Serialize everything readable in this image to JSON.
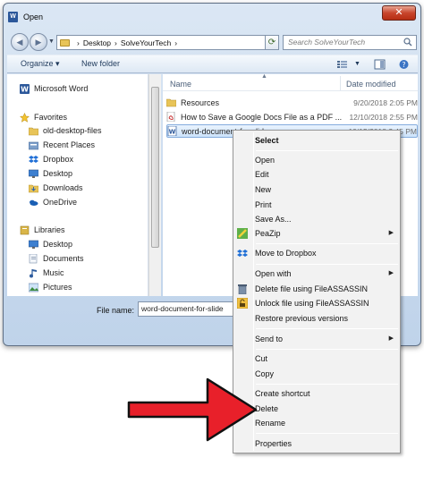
{
  "window": {
    "title": "Open",
    "app_icon": "W",
    "close_glyph": "✕"
  },
  "address": {
    "crumbs": [
      "Desktop",
      "SolveYourTech"
    ],
    "separator": "›",
    "search_placeholder": "Search SolveYourTech"
  },
  "toolbar": {
    "organize_label": "Organize ▾",
    "new_folder_label": "New folder"
  },
  "navpane": {
    "items": [
      {
        "label": "Microsoft Word",
        "icon": "word-icon"
      },
      {
        "label": "Favorites",
        "icon": "star-icon"
      },
      {
        "label": "old-desktop-files",
        "icon": "folder-icon"
      },
      {
        "label": "Recent Places",
        "icon": "recent-places-icon"
      },
      {
        "label": "Dropbox",
        "icon": "dropbox-icon"
      },
      {
        "label": "Desktop",
        "icon": "desktop-icon"
      },
      {
        "label": "Downloads",
        "icon": "downloads-icon"
      },
      {
        "label": "OneDrive",
        "icon": "onedrive-icon"
      },
      {
        "label": "Libraries",
        "icon": "libraries-icon"
      },
      {
        "label": "Desktop",
        "icon": "desktop-icon"
      },
      {
        "label": "Documents",
        "icon": "documents-icon"
      },
      {
        "label": "Music",
        "icon": "music-icon"
      },
      {
        "label": "Pictures",
        "icon": "pictures-icon"
      }
    ]
  },
  "filelist": {
    "columns": {
      "name": "Name",
      "date": "Date modified"
    },
    "files": [
      {
        "name": "Resources",
        "date": "9/20/2018 2:05 PM",
        "icon": "folder-icon"
      },
      {
        "name": "How to Save a Google Docs File as a PDF ...",
        "date": "12/10/2018 2:55 PM",
        "icon": "pdf-icon"
      },
      {
        "name": "word-document-for-slide",
        "date": "10/15/2018 2:45 PM",
        "icon": "word-doc-icon"
      }
    ]
  },
  "filename": {
    "label": "File name:",
    "value": "word-document-for-slide"
  },
  "context_menu": {
    "items": [
      {
        "label": "Select",
        "bold": true
      },
      {
        "label": "Open"
      },
      {
        "label": "Edit"
      },
      {
        "label": "New"
      },
      {
        "label": "Print"
      },
      {
        "label": "Save As..."
      },
      {
        "label": "PeaZip",
        "submenu": true,
        "icon": "peazip-icon"
      },
      {
        "label": "Move to Dropbox",
        "icon": "dropbox-icon"
      },
      {
        "label": "Open with",
        "submenu": true
      },
      {
        "label": "Delete file using FileASSASSIN",
        "icon": "trash-icon"
      },
      {
        "label": "Unlock file using FileASSASSIN",
        "icon": "unlock-icon"
      },
      {
        "label": "Restore previous versions"
      },
      {
        "label": "Send to",
        "submenu": true
      },
      {
        "label": "Cut"
      },
      {
        "label": "Copy"
      },
      {
        "label": "Create shortcut"
      },
      {
        "label": "Delete"
      },
      {
        "label": "Rename"
      },
      {
        "label": "Properties"
      }
    ],
    "submenu_arrow": "▶"
  },
  "annotation": {
    "arrow_color": "#e8202a"
  }
}
